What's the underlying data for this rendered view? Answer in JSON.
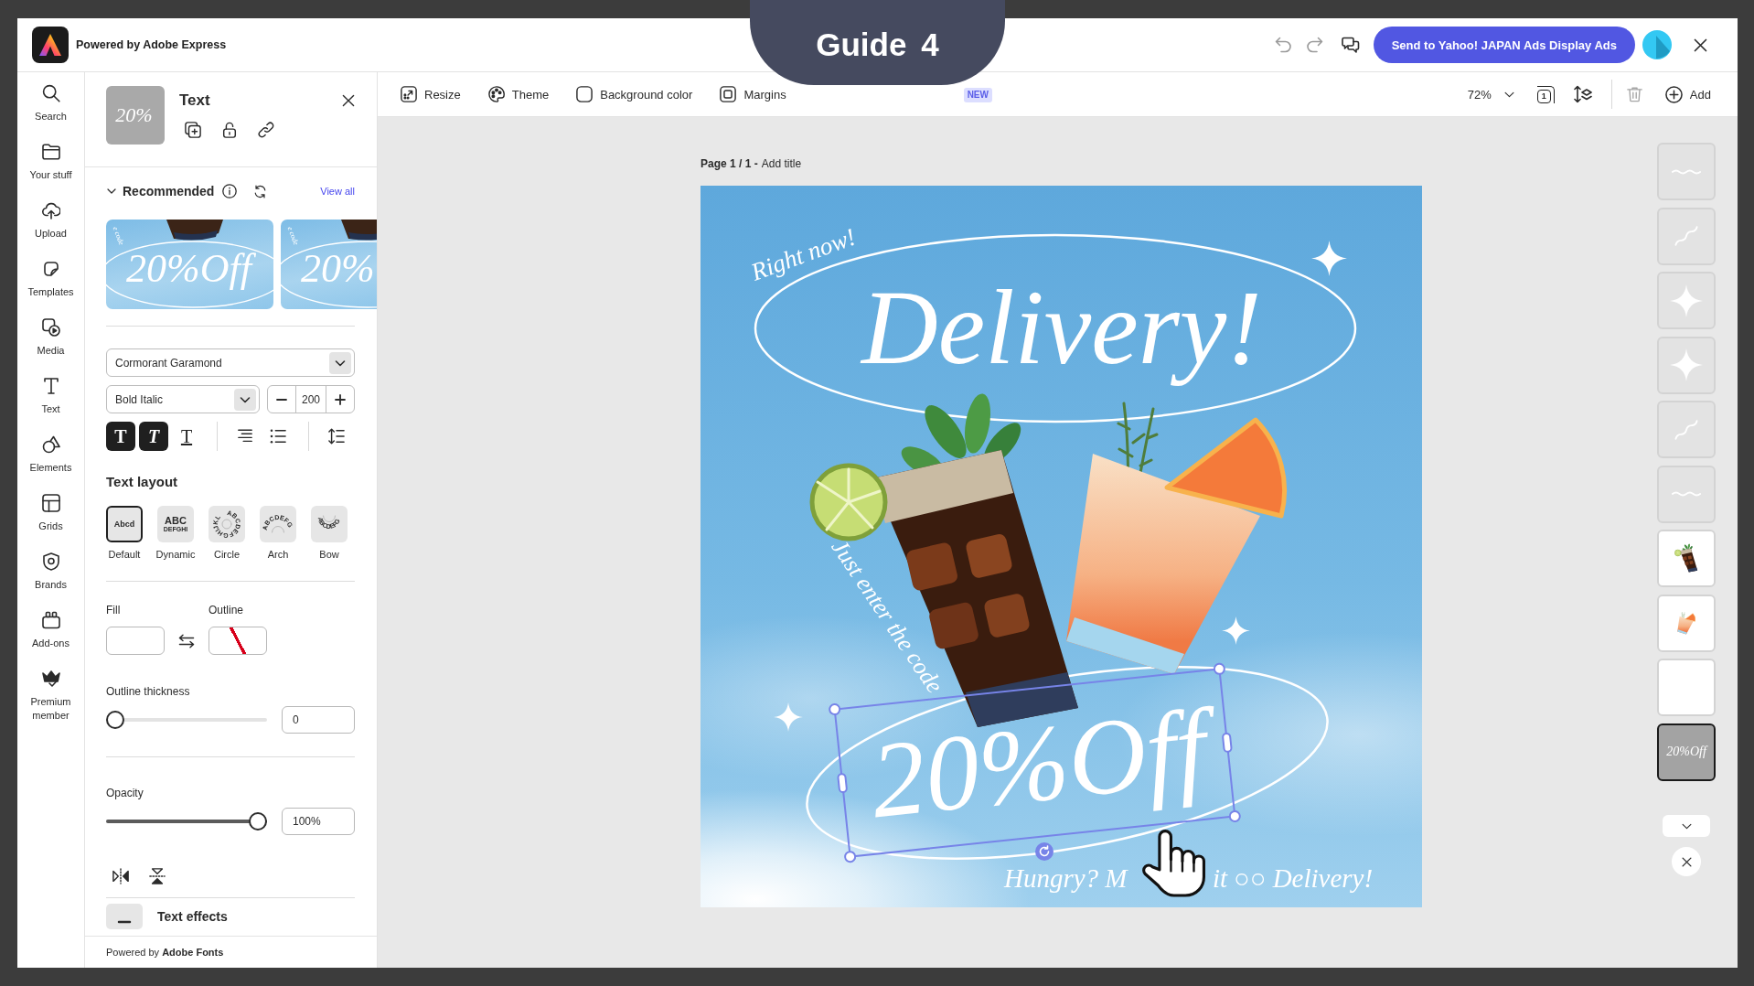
{
  "guide_badge": {
    "label": "Guide",
    "number": "4"
  },
  "header": {
    "brand": "Powered by Adobe Express",
    "history": [
      {
        "kind": "undo",
        "disabled": true
      },
      {
        "kind": "redo",
        "disabled": true
      }
    ],
    "send_button": "Send to Yahoo! JAPAN Ads Display Ads"
  },
  "rail": [
    {
      "label": "Search",
      "kind": "search",
      "selected": false
    },
    {
      "label": "Your stuff",
      "kind": "stuff",
      "selected": false
    },
    {
      "label": "Upload",
      "kind": "upload",
      "selected": false
    },
    {
      "label": "Templates",
      "kind": "templates",
      "selected": false
    },
    {
      "label": "Media",
      "kind": "media",
      "selected": false
    },
    {
      "label": "Text",
      "kind": "text",
      "selected": false
    },
    {
      "label": "Elements",
      "kind": "elements",
      "selected": false
    },
    {
      "label": "Grids",
      "kind": "grids",
      "selected": false
    },
    {
      "label": "Brands",
      "kind": "brands",
      "selected": false
    },
    {
      "label": "Add-ons",
      "kind": "addons",
      "selected": false
    },
    {
      "label": "Premium member",
      "kind": "premium",
      "selected": false
    }
  ],
  "panel": {
    "thumbnail_text": "20%",
    "title": "Text",
    "actions": [
      {
        "kind": "duplicate"
      },
      {
        "kind": "unlock"
      },
      {
        "kind": "link"
      }
    ],
    "recommended": {
      "title": "Recommended",
      "expanded": true,
      "link": "View all",
      "previews": [
        {
          "caption": "e code",
          "text": "20%Off"
        },
        {
          "caption": "e code",
          "text": "20%"
        }
      ]
    },
    "font": {
      "family": "Cormorant Garamond",
      "style": "Bold Italic",
      "size": "200"
    },
    "format_groups": [
      [
        {
          "kind": "bold",
          "glyph": "T",
          "on": true
        },
        {
          "kind": "italic",
          "glyph": "T",
          "on": true
        },
        {
          "kind": "underline",
          "glyph": "T",
          "on": false
        }
      ],
      [
        {
          "kind": "align"
        },
        {
          "kind": "list"
        }
      ],
      [
        {
          "kind": "line-spacing"
        }
      ]
    ],
    "text_layout": {
      "title": "Text layout",
      "options": [
        {
          "label": "Default",
          "kind": "default",
          "sample": "Abcd",
          "selected": true
        },
        {
          "label": "Dynamic",
          "kind": "dynamic",
          "sample": "ABC",
          "sample_2": "DEFGHI",
          "selected": false
        },
        {
          "label": "Circle",
          "kind": "circle",
          "sample": "ABCDEFGHIJKL",
          "selected": false
        },
        {
          "label": "Arch",
          "kind": "arch",
          "sample": "ABCDEFG",
          "selected": false
        },
        {
          "label": "Bow",
          "kind": "bow",
          "sample": "ABCDEFG",
          "selected": false
        }
      ]
    },
    "colors": [
      {
        "label": "Fill",
        "kind": "color",
        "color": "#ffffff"
      },
      {
        "label": "Outline",
        "kind": "none"
      }
    ],
    "sliders": [
      {
        "label": "Outline thickness",
        "level": 0,
        "value": "0"
      },
      {
        "label": "Opacity",
        "level": 1,
        "value": "100%"
      }
    ],
    "flip": [
      {
        "kind": "horizontal"
      },
      {
        "kind": "vertical"
      }
    ],
    "sections": [
      {
        "title": "Text effects"
      }
    ],
    "footer": "Powered by **Adobe Fonts**"
  },
  "toolbar": {
    "items": [
      {
        "label": "Resize",
        "kind": "resize"
      },
      {
        "label": "Theme",
        "kind": "theme"
      },
      {
        "label": "Background color",
        "kind": "background"
      },
      {
        "label": "Margins",
        "kind": "margins"
      }
    ],
    "badge": "NEW",
    "zoom": "72%",
    "tools": [
      {
        "kind": "pages",
        "count": "1"
      },
      {
        "kind": "layers"
      },
      {
        "kind": "delete",
        "disabled": true
      }
    ],
    "add": "Add"
  },
  "canvas": {
    "page_label": "Page 1 / 1 -",
    "title_link": "Add title",
    "texts": [
      {
        "kind": "tagline",
        "text": "Right now!",
        "selected": false
      },
      {
        "kind": "headline",
        "text": "Delivery!",
        "selected": false
      },
      {
        "kind": "note",
        "text": "Just enter the code",
        "selected": false
      },
      {
        "kind": "discount",
        "text": "20%Off",
        "selected": true
      },
      {
        "kind": "footer-start",
        "text": "Hungry? M",
        "selected": false
      },
      {
        "kind": "footer-end",
        "text": "it ○○ Delivery!",
        "selected": false
      }
    ],
    "layers": [
      {
        "kind": "text",
        "selected": false
      },
      {
        "kind": "text-angled",
        "selected": false
      },
      {
        "kind": "sparkle",
        "selected": false
      },
      {
        "kind": "sparkle",
        "selected": false
      },
      {
        "kind": "text-angled",
        "selected": false
      },
      {
        "kind": "text",
        "selected": false
      },
      {
        "kind": "cola",
        "selected": false
      },
      {
        "kind": "cocktail",
        "selected": false
      },
      {
        "kind": "blank",
        "selected": false
      },
      {
        "kind": "text",
        "label": "20%Off",
        "selected": true
      }
    ]
  }
}
